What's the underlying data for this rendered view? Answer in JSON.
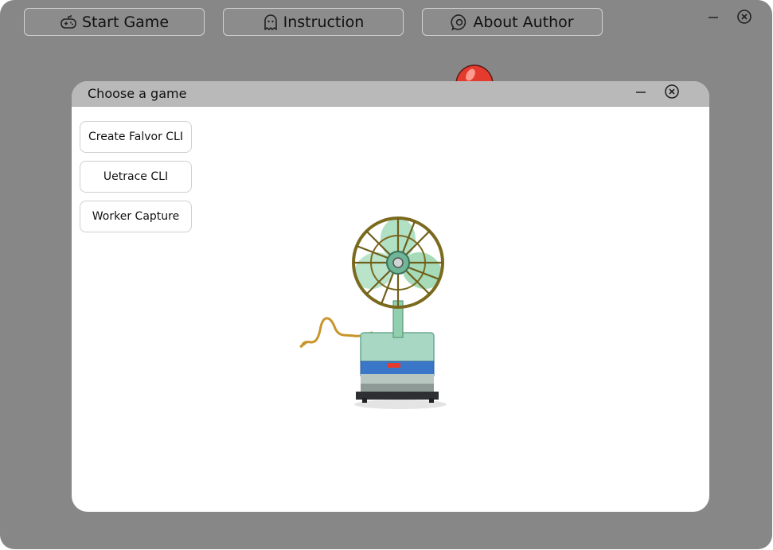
{
  "toolbar": {
    "start_game": {
      "label": "Start Game",
      "icon": "gamepad-icon"
    },
    "instruction": {
      "label": "Instruction",
      "icon": "ghost-icon"
    },
    "about_author": {
      "label": "About Author",
      "icon": "chat-bubble-icon"
    }
  },
  "window_controls": {
    "minimize": "minimize-icon",
    "close": "close-circle-icon"
  },
  "dialog": {
    "title": "Choose a game",
    "games": [
      {
        "label": "Create Falvor CLI"
      },
      {
        "label": "Uetrace CLI"
      },
      {
        "label": "Worker Capture"
      }
    ],
    "illustration": "electric-fan-drawing"
  },
  "colors": {
    "window_bg": "#878787",
    "dialog_titlebar": "#b9b9b9",
    "dialog_body": "#ffffff",
    "button_border": "#d2d2d2",
    "balloon_red": "#e53b2f"
  }
}
